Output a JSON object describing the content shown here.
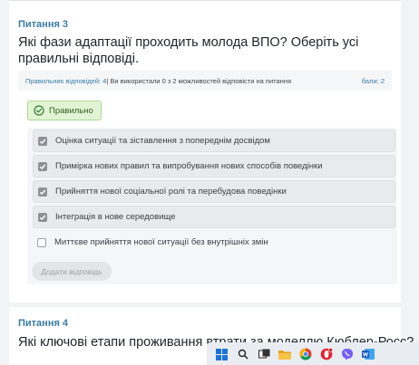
{
  "question3": {
    "label": "Питання 3",
    "title": "Які фази адаптації проходить молода ВПО? Оберіть усі правильні відповіді.",
    "info_correct": "Правильних відповідей: 4",
    "info_used": " | Ви використали 0 з 2 можливостей відповісти на питання",
    "score": "бали: 2",
    "status": "Правильно",
    "answers": [
      {
        "text": "Оцінка ситуації та зіставлення з попереднім досвідом",
        "checked": true
      },
      {
        "text": "Примірка нових правил та випробування нових способів поведінки",
        "checked": true
      },
      {
        "text": "Прийняття нової соціальної ролі та перебудова поведінки",
        "checked": true
      },
      {
        "text": "Інтеграція в нове середовище",
        "checked": true
      },
      {
        "text": "Миттєве прийняття нової ситуації без внутрішніх змін",
        "checked": false
      }
    ],
    "add_answer_label": "Додати відповідь"
  },
  "question4": {
    "label": "Питання 4",
    "title": "Які ключові етапи проживання втрати за моделлю Кюблер-Росс?"
  },
  "colors": {
    "accent": "#3a7ca5",
    "correct_bg": "#e3f4d6",
    "correct_border": "#a9d88a",
    "checkbox_checked": "#8d9298"
  },
  "taskbar": {
    "icons": [
      "windows-start-icon",
      "search-icon",
      "task-view-icon",
      "file-explorer-icon",
      "chrome-icon",
      "opera-icon",
      "viber-icon",
      "word-icon"
    ]
  }
}
